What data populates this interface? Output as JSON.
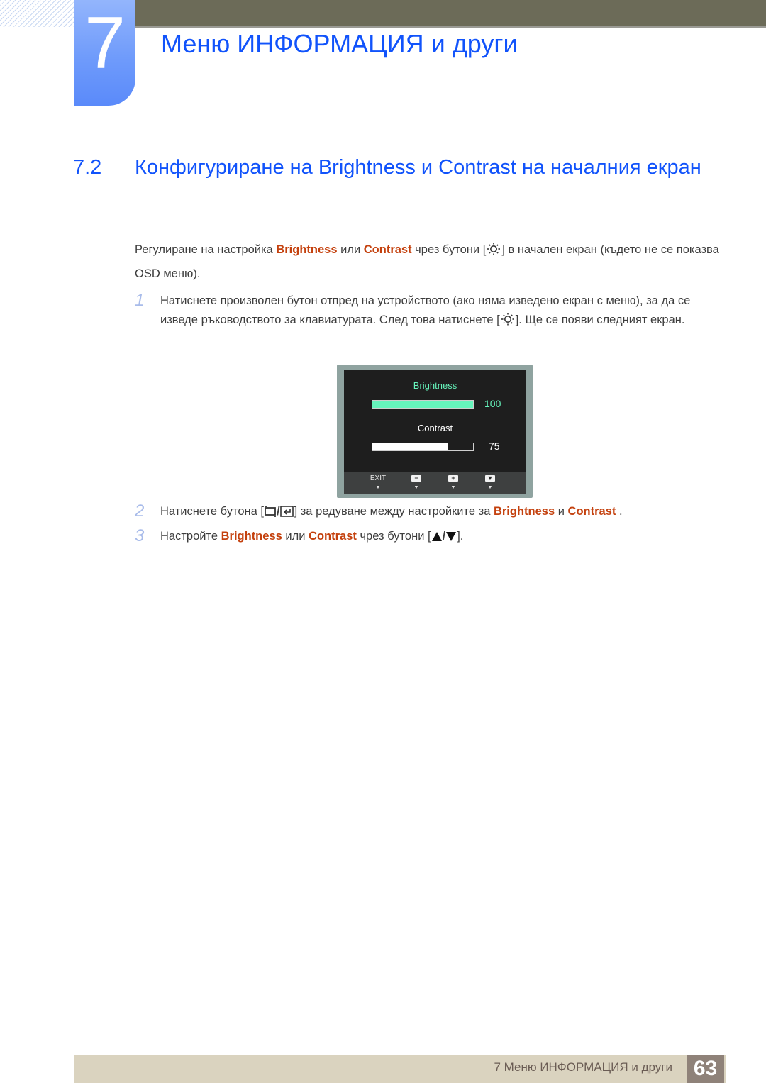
{
  "header": {
    "chapter_number": "7",
    "chapter_title": "Меню ИНФОРМАЦИЯ и други"
  },
  "section": {
    "number": "7.2",
    "title": "Конфигуриране на Brightness и Contrast на началния екран"
  },
  "intro": {
    "part1": "Регулиране на настройка ",
    "brightness": "Brightness",
    "part2": " или ",
    "contrast": "Contrast",
    "part3": " чрез бутони [",
    "icon": "sun-icon",
    "part4": "] в начален екран (където не се показва OSD меню)."
  },
  "steps": [
    {
      "number": "1",
      "text1": "Натиснете произволен бутон отпред на устройството (ако няма изведено екран с меню), за да се изведе ръководството за клавиатурата. След това натиснете [",
      "icon": "sun-icon",
      "text2": "]. Ще се появи следният екран."
    },
    {
      "number": "2",
      "text1": "Натиснете бутона [",
      "icons": [
        "source-icon",
        "enter-icon"
      ],
      "separator": "/",
      "text2": "] за редуване между настройките за ",
      "brightness": "Brightness",
      "text3": " и ",
      "contrast": "Contrast",
      "text4": " ."
    },
    {
      "number": "3",
      "text1": "Настройте ",
      "brightness": "Brightness",
      "text2": " или ",
      "contrast": "Contrast",
      "text3": " чрез бутони [",
      "icons": [
        "triangle-up-icon",
        "triangle-down-icon"
      ],
      "separator": "/",
      "text4": "]."
    }
  ],
  "osd": {
    "brightness_label": "Brightness",
    "brightness_value": "100",
    "brightness_level": 100,
    "contrast_label": "Contrast",
    "contrast_value": "75",
    "contrast_level": 75,
    "buttons": [
      {
        "label": "EXIT",
        "icon": "exit-label"
      },
      {
        "label": "",
        "icon": "minus-icon",
        "glyph": "−"
      },
      {
        "label": "",
        "icon": "plus-icon",
        "glyph": "+"
      },
      {
        "label": "",
        "icon": "down-icon",
        "glyph": "▼"
      }
    ],
    "colors": {
      "brightness": "#66f5bc",
      "contrast": "#ffffff"
    }
  },
  "footer": {
    "text": "7 Меню ИНФОРМАЦИЯ и други",
    "page_number": "63"
  },
  "colors": {
    "accent_blue": "#1153fb",
    "highlight": "#c4410e"
  }
}
